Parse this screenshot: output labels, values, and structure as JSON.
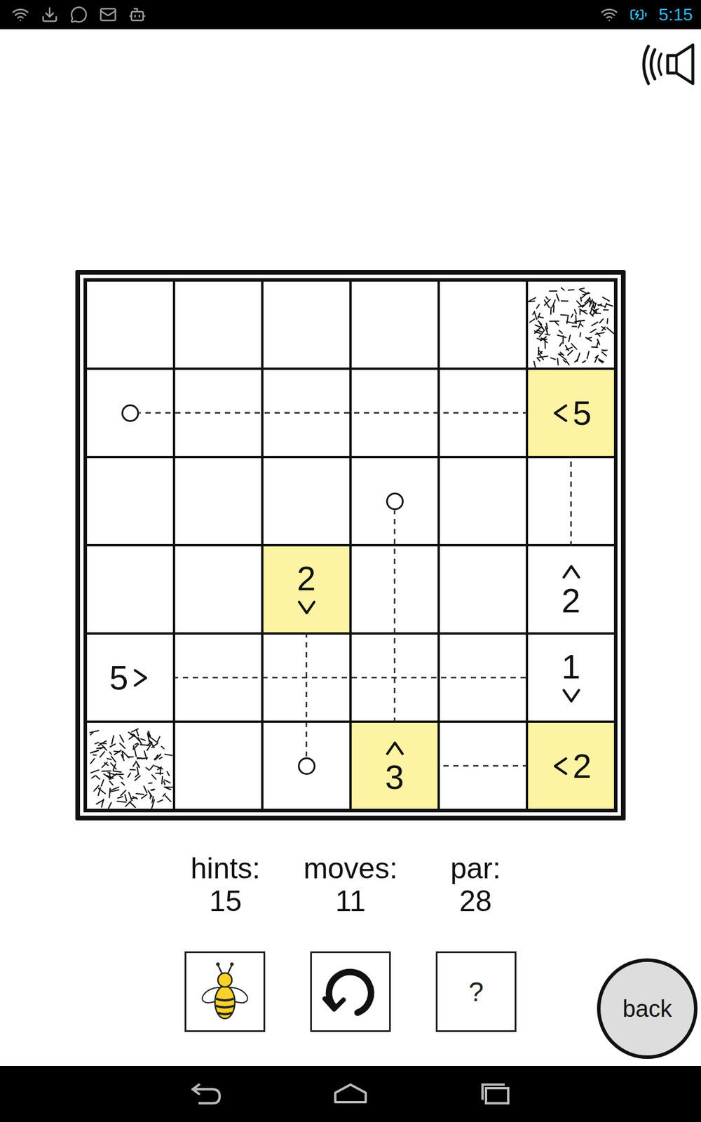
{
  "status_bar": {
    "time": "5:15"
  },
  "board": {
    "rows": [
      [
        {
          "kind": "empty"
        },
        {
          "kind": "empty"
        },
        {
          "kind": "empty"
        },
        {
          "kind": "empty"
        },
        {
          "kind": "empty"
        },
        {
          "kind": "grass"
        }
      ],
      [
        {
          "kind": "target"
        },
        {
          "kind": "empty"
        },
        {
          "kind": "empty"
        },
        {
          "kind": "empty"
        },
        {
          "kind": "empty"
        },
        {
          "kind": "tile",
          "value": "5",
          "direction": "left",
          "highlighted": true
        }
      ],
      [
        {
          "kind": "empty"
        },
        {
          "kind": "empty"
        },
        {
          "kind": "empty"
        },
        {
          "kind": "target"
        },
        {
          "kind": "empty"
        },
        {
          "kind": "empty"
        }
      ],
      [
        {
          "kind": "empty"
        },
        {
          "kind": "empty"
        },
        {
          "kind": "tile",
          "value": "2",
          "direction": "down",
          "highlighted": true
        },
        {
          "kind": "empty"
        },
        {
          "kind": "empty"
        },
        {
          "kind": "tile",
          "value": "2",
          "direction": "up",
          "highlighted": false
        }
      ],
      [
        {
          "kind": "tile",
          "value": "5",
          "direction": "right",
          "highlighted": false
        },
        {
          "kind": "empty"
        },
        {
          "kind": "empty"
        },
        {
          "kind": "empty"
        },
        {
          "kind": "empty"
        },
        {
          "kind": "tile",
          "value": "1",
          "direction": "down",
          "highlighted": false
        }
      ],
      [
        {
          "kind": "grass"
        },
        {
          "kind": "empty"
        },
        {
          "kind": "target"
        },
        {
          "kind": "tile",
          "value": "3",
          "direction": "up",
          "highlighted": true
        },
        {
          "kind": "empty"
        },
        {
          "kind": "tile",
          "value": "2",
          "direction": "left",
          "highlighted": true
        }
      ]
    ]
  },
  "stats": [
    {
      "label": "hints:",
      "value": "15"
    },
    {
      "label": "moves:",
      "value": "11"
    },
    {
      "label": "par:",
      "value": "28"
    }
  ],
  "toolbar": [
    {
      "kind": "bee"
    },
    {
      "kind": "restart"
    },
    {
      "kind": "help",
      "label": "?"
    }
  ],
  "back_button": {
    "label": "back"
  }
}
